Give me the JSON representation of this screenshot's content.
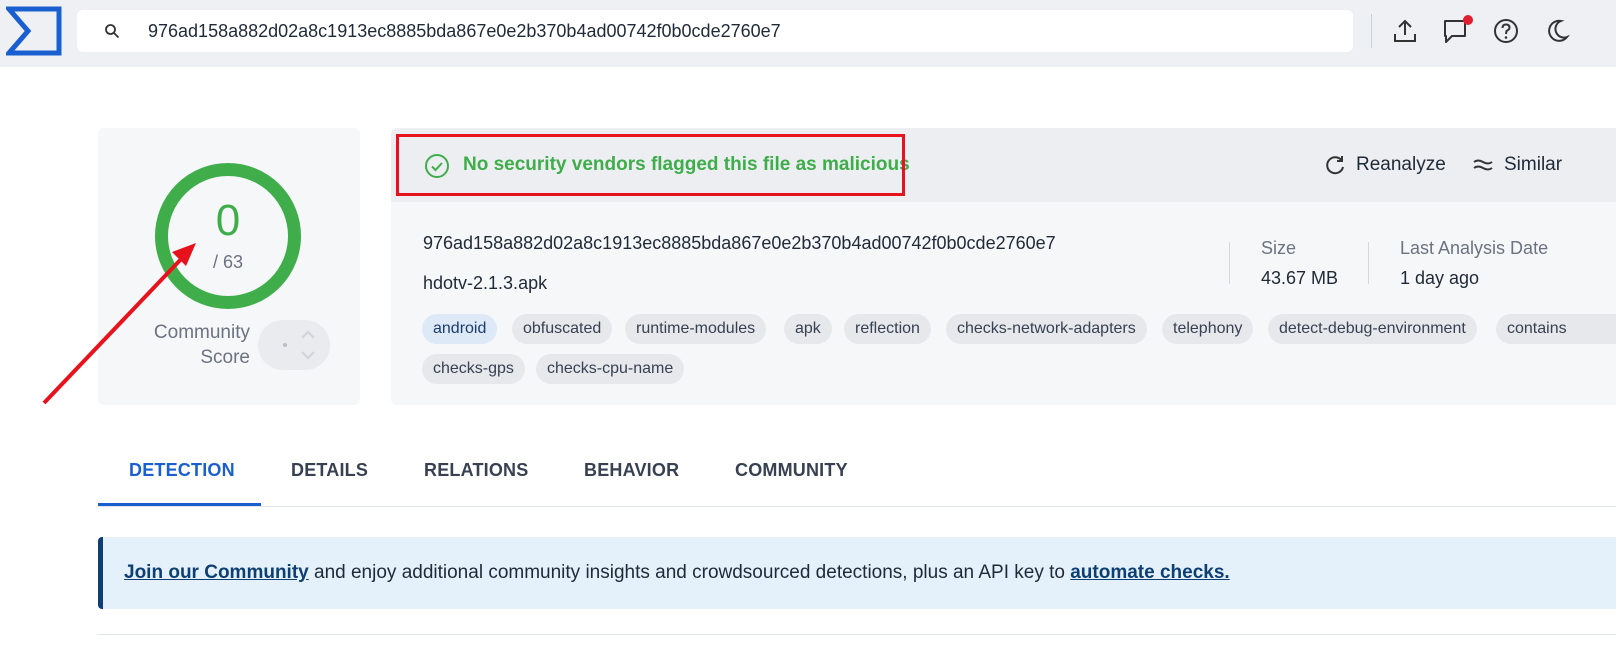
{
  "topbar": {
    "search_value": "976ad158a882d02a8c1913ec8885bda867e0e2b370b4ad00742f0b0cde2760e7",
    "icons": [
      "upload-icon",
      "chat-icon",
      "help-icon",
      "dark-mode-icon"
    ]
  },
  "score": {
    "value": "0",
    "total": "/ 63",
    "community_line1": "Community",
    "community_line2": "Score"
  },
  "header": {
    "flag_message": "No security vendors flagged this file as malicious",
    "reanalyze_label": "Reanalyze",
    "similar_label": "Similar"
  },
  "file": {
    "hash": "976ad158a882d02a8c1913ec8885bda867e0e2b370b4ad00742f0b0cde2760e7",
    "name": "hdotv-2.1.3.apk",
    "size_label": "Size",
    "size_value": "43.67 MB",
    "date_label": "Last Analysis Date",
    "date_value": "1 day ago"
  },
  "tags": [
    "android",
    "obfuscated",
    "runtime-modules",
    "apk",
    "reflection",
    "checks-network-adapters",
    "telephony",
    "detect-debug-environment",
    "contains",
    "checks-gps",
    "checks-cpu-name"
  ],
  "tabs": [
    "DETECTION",
    "DETAILS",
    "RELATIONS",
    "BEHAVIOR",
    "COMMUNITY"
  ],
  "banner": {
    "link1": "Join our Community",
    "middle": " and enjoy additional community insights and crowdsourced detections, plus an API key to ",
    "link2": "automate checks."
  },
  "colors": {
    "accent_blue": "#1a5fd0",
    "green": "#3fae4a",
    "annotation_red": "#e8121c"
  }
}
